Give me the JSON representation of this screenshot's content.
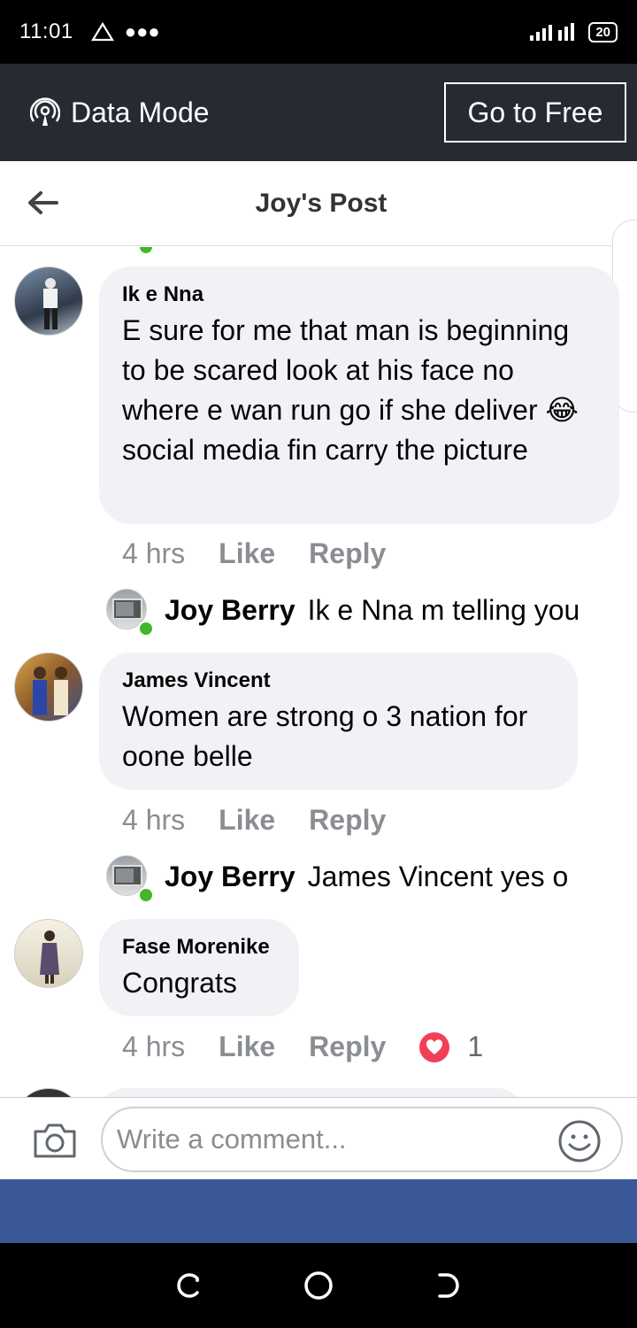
{
  "status_bar": {
    "time": "11:01",
    "battery": "20",
    "signal": "4G"
  },
  "data_banner": {
    "label": "Data Mode",
    "button": "Go to Free"
  },
  "header": {
    "title": "Joy's Post"
  },
  "comments": [
    {
      "author": "Ik e Nna",
      "text": "E sure for me that man is beginning to be scared look at his face no where e wan run go if she deliver 😂 social media fin carry the picture",
      "time": "4 hrs",
      "like": "Like",
      "reply": "Reply",
      "reply_preview": {
        "name": "Joy Berry",
        "text": "Ik e Nna m telling you"
      }
    },
    {
      "author": "James Vincent",
      "text": "Women are strong o 3 nation for oone belle",
      "time": "4 hrs",
      "like": "Like",
      "reply": "Reply",
      "reply_preview": {
        "name": "Joy Berry",
        "text": "James Vincent yes o"
      }
    },
    {
      "author": "Fase Morenike",
      "text": "Congrats",
      "time": "4 hrs",
      "like": "Like",
      "reply": "Reply",
      "reaction_count": "1"
    }
  ],
  "composer": {
    "placeholder": "Write a comment..."
  },
  "colors": {
    "data_bar": "#262a33",
    "bubble": "#f0f2f5",
    "online": "#42b72a",
    "fb_blue": "#3b5998",
    "heart": "#f33e58"
  }
}
